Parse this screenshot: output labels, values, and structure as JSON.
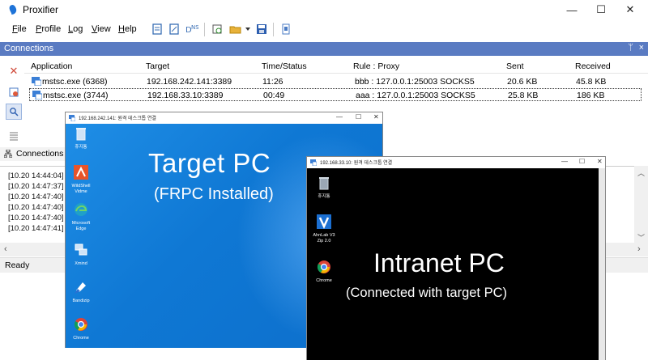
{
  "app": {
    "title": "Proxifier",
    "window_controls": {
      "minimize": "—",
      "maximize": "☐",
      "close": "✕"
    }
  },
  "menu": [
    "File",
    "Profile",
    "Log",
    "View",
    "Help"
  ],
  "connections_panel": {
    "label": "Connections",
    "pin": "ᛘ",
    "close": "×",
    "columns": [
      "Application",
      "Target",
      "Time/Status",
      "Rule : Proxy",
      "Sent",
      "Received"
    ],
    "rows": [
      {
        "application": "mstsc.exe (6368)",
        "target": "192.168.242.141:3389",
        "time": "11:26",
        "rule_proxy": "bbb : 127.0.0.1:25003 SOCKS5",
        "sent": "20.6 KB",
        "received": "45.8 KB"
      },
      {
        "application": "mstsc.exe (3744)",
        "target": "192.168.33.10:3389",
        "time": "00:49",
        "rule_proxy": "aaa : 127.0.0.1:25003 SOCKS5",
        "sent": "25.8 KB",
        "received": "186 KB"
      }
    ]
  },
  "tabs": {
    "connections": "Connections"
  },
  "log": [
    "[10.20 14:44:04]",
    "[10.20 14:47:37]",
    "[10.20 14:47:40]",
    "[10.20 14:47:40]",
    "[10.20 14:47:40]",
    "[10.20 14:47:41]"
  ],
  "status": "Ready",
  "rdp_target": {
    "title": "192.168.242.141: 원격 데스크톱 연결",
    "headline": "Target PC",
    "subline_open": "(",
    "subline_highlight": "FRPC",
    "subline_rest": " Installed)",
    "icons": [
      "휴지통",
      "WildShell Vidme",
      "Microsoft Edge",
      "Xmind",
      "Bandizip",
      "Chrome"
    ]
  },
  "rdp_intranet": {
    "title": "192.168.33.10: 원격 데스크톱 연결",
    "headline": "Intranet PC",
    "subline": "(Connected with target PC)",
    "icons": [
      "휴지통",
      "AhnLab V3 Zip 2.0",
      "Chrome"
    ]
  },
  "colors": {
    "connections_header": "#5a7bc2",
    "target_desktop": "#0f78d4",
    "intranet_desktop": "#000000"
  }
}
